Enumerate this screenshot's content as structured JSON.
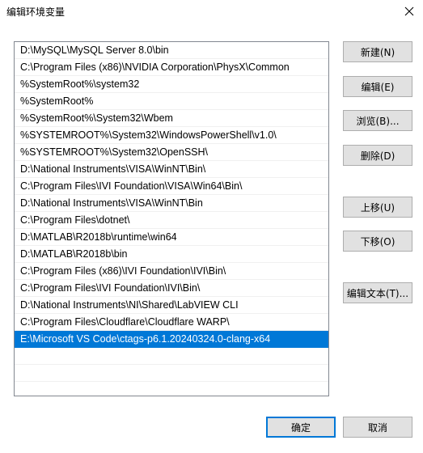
{
  "window": {
    "title": "编辑环境变量",
    "close_icon": "close-icon"
  },
  "paths": [
    "D:\\MySQL\\MySQL Server 8.0\\bin",
    "C:\\Program Files (x86)\\NVIDIA Corporation\\PhysX\\Common",
    "%SystemRoot%\\system32",
    "%SystemRoot%",
    "%SystemRoot%\\System32\\Wbem",
    "%SYSTEMROOT%\\System32\\WindowsPowerShell\\v1.0\\",
    "%SYSTEMROOT%\\System32\\OpenSSH\\",
    "D:\\National Instruments\\VISA\\WinNT\\Bin\\",
    "C:\\Program Files\\IVI Foundation\\VISA\\Win64\\Bin\\",
    "D:\\National Instruments\\VISA\\WinNT\\Bin",
    "C:\\Program Files\\dotnet\\",
    "D:\\MATLAB\\R2018b\\runtime\\win64",
    "D:\\MATLAB\\R2018b\\bin",
    "C:\\Program Files (x86)\\IVI Foundation\\IVI\\Bin\\",
    "C:\\Program Files\\IVI Foundation\\IVI\\Bin\\",
    "D:\\National Instruments\\NI\\Shared\\LabVIEW CLI",
    "C:\\Program Files\\Cloudflare\\Cloudflare WARP\\",
    "E:\\Microsoft VS Code\\ctags-p6.1.20240324.0-clang-x64"
  ],
  "selected_index": 17,
  "buttons": {
    "new": "新建(N)",
    "edit": "编辑(E)",
    "browse": "浏览(B)...",
    "delete": "删除(D)",
    "move_up": "上移(U)",
    "move_down": "下移(O)",
    "edit_text": "编辑文本(T)...",
    "ok": "确定",
    "cancel": "取消"
  },
  "colors": {
    "selection": "#0078d7",
    "button_bg": "#e1e1e1"
  }
}
